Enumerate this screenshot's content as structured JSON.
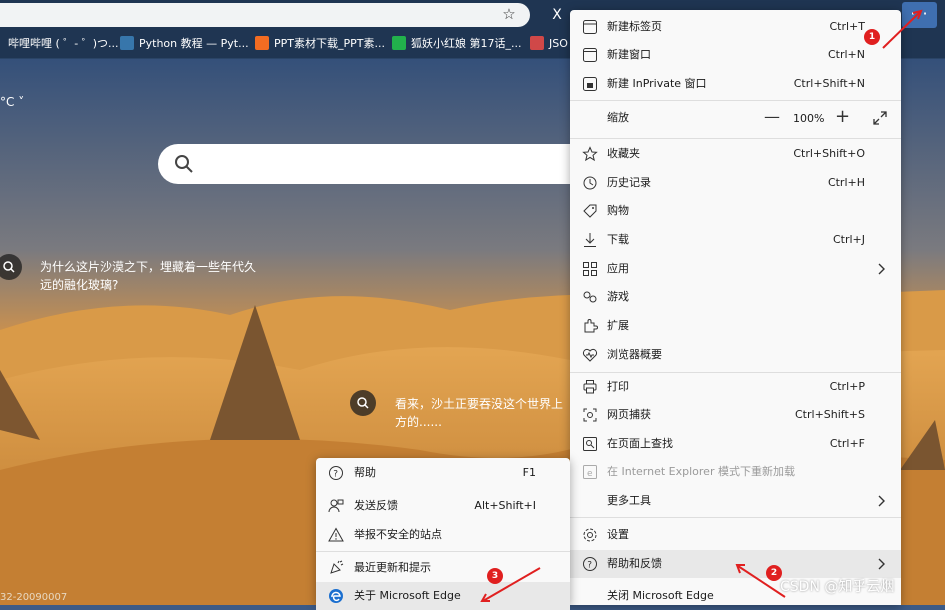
{
  "toolbar": {
    "star_icon": "star-icon",
    "ext_letter": "X",
    "more_label": "···"
  },
  "favorites": [
    {
      "label": "哔哩哔哩 ( ゜- ゜)つ...",
      "color": "#fb7299"
    },
    {
      "label": "Python 教程 — Pyt...",
      "color": "#3776ab"
    },
    {
      "label": "PPT素材下载_PPT素...",
      "color": "#f26c22"
    },
    {
      "label": "狐妖小红娘 第17话_...",
      "color": "#22b14c"
    },
    {
      "label": "JSO",
      "color": "#d04848"
    }
  ],
  "weather": "°C",
  "captions": [
    {
      "text": "为什么这片沙漠之下，埋藏着一些年代久\n远的融化玻璃?"
    },
    {
      "text": "看来，沙土正要吞没这个世界上\n方的......"
    }
  ],
  "bottom_text": "32-20090007",
  "menu": {
    "items": [
      {
        "label": "新建标签页",
        "shortcut": "Ctrl+T",
        "icon": "new-tab-icon"
      },
      {
        "label": "新建窗口",
        "shortcut": "Ctrl+N",
        "icon": "new-window-icon"
      },
      {
        "label": "新建 InPrivate 窗口",
        "shortcut": "Ctrl+Shift+N",
        "icon": "inprivate-icon"
      },
      {
        "label": "缩放",
        "zoom": "100%",
        "icon": ""
      },
      {
        "label": "收藏夹",
        "shortcut": "Ctrl+Shift+O",
        "icon": "favorites-icon"
      },
      {
        "label": "历史记录",
        "shortcut": "Ctrl+H",
        "icon": "history-icon"
      },
      {
        "label": "购物",
        "shortcut": "",
        "icon": "shopping-icon"
      },
      {
        "label": "下载",
        "shortcut": "Ctrl+J",
        "icon": "download-icon"
      },
      {
        "label": "应用",
        "shortcut": "",
        "icon": "apps-icon"
      },
      {
        "label": "游戏",
        "shortcut": "",
        "icon": "games-icon"
      },
      {
        "label": "扩展",
        "shortcut": "",
        "icon": "extensions-icon"
      },
      {
        "label": "浏览器概要",
        "shortcut": "",
        "icon": "browser-essentials-icon"
      },
      {
        "label": "打印",
        "shortcut": "Ctrl+P",
        "icon": "print-icon"
      },
      {
        "label": "网页捕获",
        "shortcut": "Ctrl+Shift+S",
        "icon": "web-capture-icon"
      },
      {
        "label": "在页面上查找",
        "shortcut": "Ctrl+F",
        "icon": "find-icon"
      },
      {
        "label": "在 Internet Explorer 模式下重新加载",
        "shortcut": "",
        "icon": "ie-mode-icon"
      },
      {
        "label": "更多工具",
        "shortcut": "",
        "icon": ""
      },
      {
        "label": "设置",
        "shortcut": "",
        "icon": "settings-icon"
      },
      {
        "label": "帮助和反馈",
        "shortcut": "",
        "icon": "help-icon"
      },
      {
        "label": "关闭 Microsoft Edge",
        "shortcut": "",
        "icon": ""
      }
    ]
  },
  "submenu": {
    "items": [
      {
        "label": "帮助",
        "shortcut": "F1",
        "icon": "help-icon"
      },
      {
        "label": "发送反馈",
        "shortcut": "Alt+Shift+I",
        "icon": "feedback-icon"
      },
      {
        "label": "举报不安全的站点",
        "shortcut": "",
        "icon": "warning-icon"
      },
      {
        "label": "最近更新和提示",
        "shortcut": "",
        "icon": "whats-new-icon"
      },
      {
        "label": "关于 Microsoft Edge",
        "shortcut": "",
        "icon": "edge-logo-icon"
      }
    ]
  },
  "badges": [
    "1",
    "2",
    "3"
  ],
  "watermark": "CSDN @知乎云烟",
  "colors": {
    "annotation_red": "#e02020",
    "menu_bg": "#f9f9f9",
    "highlight": "#e8e8e8"
  }
}
